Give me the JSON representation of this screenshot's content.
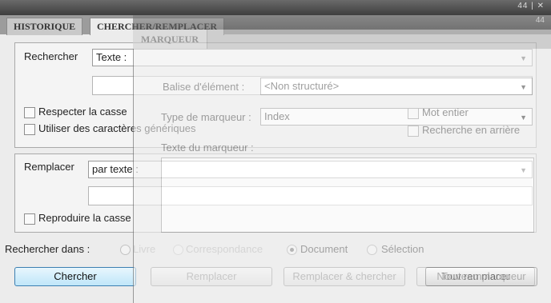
{
  "window": {
    "controls": "44 | ✕"
  },
  "tabs": [
    {
      "label": "HISTORIQUE"
    },
    {
      "label": "CHERCHER/REMPLACER"
    }
  ],
  "search": {
    "label": "Rechercher",
    "mode_selected": "Texte :",
    "input_value": "",
    "match_case_label": "Respecter la casse",
    "match_case_checked": false,
    "wildcards_label": "Utiliser des caractères génériques",
    "wildcards_checked": false
  },
  "replace": {
    "label": "Remplacer",
    "mode_selected": "par texte :",
    "input_value": "",
    "preserve_case_label": "Reproduire la casse",
    "preserve_case_checked": false
  },
  "scope": {
    "label": "Rechercher dans :",
    "options": [
      {
        "label": "Livre",
        "selected": false,
        "enabled": false
      },
      {
        "label": "Correspondance",
        "selected": false,
        "enabled": false
      },
      {
        "label": "Document",
        "selected": true,
        "enabled": true
      },
      {
        "label": "Sélection",
        "selected": false,
        "enabled": true
      }
    ]
  },
  "buttons": {
    "find": "Chercher",
    "replace": "Remplacer",
    "replace_find": "Remplacer & chercher",
    "replace_all": "Tout remplacer"
  },
  "overlay": {
    "tab_label": "MARQUEUR",
    "controls": "44",
    "element_tag_label": "Balise d'élément :",
    "element_tag_value": "<Non structuré>",
    "marker_type_label": "Type de marqueur :",
    "marker_type_value": "Index",
    "whole_word_label": "Mot entier",
    "search_backwards_label": "Recherche en arrière",
    "marker_text_label": "Texte du marqueur :",
    "new_marker_button": "Nouveau marqueur"
  },
  "colors": {
    "primary_button": "#bfe6f9",
    "titlebar": "#4a4a4a"
  }
}
